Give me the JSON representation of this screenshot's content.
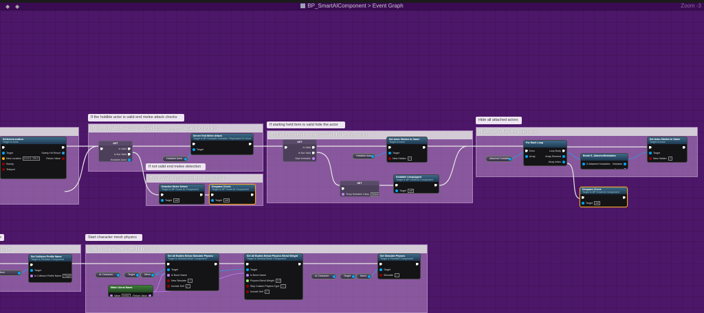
{
  "toolbar": {
    "breadcrumb_blueprint": "BP_SmartAIComponent",
    "breadcrumb_separator": ">",
    "breadcrumb_graph": "Event Graph",
    "zoom": "Zoom -3",
    "back_icon": "arrow-left-icon",
    "forward_icon": "arrow-right-icon"
  },
  "comments": [
    {
      "bubble": "",
      "title": ""
    },
    {
      "bubble": "If the holdble actor is valid end melee attack checks",
      "title": "If the holdble actor is valid end melee attack checks"
    },
    {
      "bubble": "If not valid end melee detection",
      "title": "If not valid end melee detection"
    },
    {
      "bubble": "If starting held item is valid hide the actor",
      "title": "If starting held item is valid hide the actor"
    },
    {
      "bubble": "Hide all attached actors",
      "title": "Hide all attached actors"
    },
    {
      "bubble": "e",
      "title": "rofile"
    },
    {
      "bubble": "Start character mesh physics",
      "title": "Start character mesh physics"
    }
  ],
  "colors": {
    "exec": "#ffffff",
    "object": "#00a8f4",
    "bool": "#920101",
    "name": "#c87eff",
    "float": "#9ef26b",
    "vector": "#f5b50b",
    "selected": "#f5a623"
  },
  "variables": [
    "Holdable Actor",
    "Holdable Actor",
    "Attached Holdables",
    "Mesh",
    "AI Character",
    "Target",
    "Mesh",
    "AI Character",
    "Target",
    "Mesh"
  ],
  "nodes": [
    {
      "title": "SetActorLocation",
      "sub": "Target is Actor",
      "in": [
        [
          "exec",
          ""
        ],
        [
          "object",
          "Target"
        ],
        [
          "vector",
          "New Location",
          "0.0  0.0  -700.0"
        ],
        [
          "bool",
          "Sweep",
          ""
        ],
        [
          "bool",
          "Teleport",
          ""
        ]
      ],
      "out": [
        [
          "exec",
          ""
        ],
        [
          "struct",
          "Sweep Hit Result"
        ],
        [
          "bool",
          "Return Value"
        ]
      ]
    },
    {
      "kind": "macro",
      "title": "GET",
      "in": [
        [
          "exec",
          ""
        ]
      ],
      "out": [
        [
          "exec",
          "Is Valid"
        ],
        [
          "exec",
          "Is Not Valid"
        ],
        [
          "object",
          "Holdable Actor"
        ]
      ]
    },
    {
      "title": "Server End Melee Attack",
      "sub": "Target is BP Holdable Holdable / Replicated To Server (if owning client)",
      "in": [
        [
          "exec",
          ""
        ],
        [
          "object",
          "Target"
        ]
      ],
      "out": [
        [
          "exec",
          ""
        ]
      ]
    },
    {
      "title": "Deactive Melee Detect",
      "sub": "Target is BP Smart AI Component",
      "in": [
        [
          "exec",
          ""
        ],
        [
          "object",
          "Target",
          "self"
        ]
      ],
      "out": [
        [
          "exec",
          ""
        ]
      ]
    },
    {
      "kind": "sel",
      "title": "Despawn Check",
      "sub": "Target is BP Smart AI Component",
      "in": [
        [
          "exec",
          ""
        ],
        [
          "object",
          "Target",
          "self"
        ]
      ],
      "out": [
        [
          "exec",
          ""
        ]
      ]
    },
    {
      "kind": "macro",
      "title": "GET",
      "in": [
        [
          "exec",
          ""
        ]
      ],
      "out": [
        [
          "exec",
          "Is Valid"
        ],
        [
          "exec",
          "Is Not Valid"
        ],
        [
          "name",
          "Start Holdable"
        ]
      ]
    },
    {
      "title": "Set Actor Hidden In Game",
      "sub": "Target is Actor",
      "in": [
        [
          "exec",
          ""
        ],
        [
          "object",
          "Target"
        ],
        [
          "bool",
          "New Hidden",
          "✓"
        ]
      ],
      "out": [
        [
          "exec",
          ""
        ]
      ]
    },
    {
      "kind": "set",
      "title": "SET",
      "in": [
        [
          "exec",
          ""
        ],
        [
          "name",
          "Temp Holdable Class",
          "Select Class"
        ]
      ],
      "out": [
        [
          "exec",
          ""
        ],
        [
          "name",
          ""
        ]
      ]
    },
    {
      "title": "Holdable Unequipped",
      "sub": "Target is BP Smart AI Component",
      "in": [
        [
          "exec",
          ""
        ],
        [
          "object",
          "Target",
          "self"
        ]
      ],
      "out": [
        [
          "exec",
          ""
        ]
      ]
    },
    {
      "title": "For Each Loop",
      "sub": "",
      "in": [
        [
          "exec",
          "Exec"
        ],
        [
          "object",
          "Array"
        ]
      ],
      "out": [
        [
          "exec",
          "Loop Body"
        ],
        [
          "object",
          "Array Element"
        ],
        [
          "object",
          "Array Index"
        ],
        [
          "exec",
          "Completed"
        ]
      ]
    },
    {
      "title": "Break S_AttachedHoldables",
      "sub": "",
      "in": [
        [
          "object",
          "S Attached Holdables"
        ]
      ],
      "out": [
        [
          "object",
          "Holdable"
        ],
        [
          "name",
          "Socket"
        ]
      ]
    },
    {
      "title": "Set Actor Hidden In Game",
      "sub": "Target is Actor",
      "in": [
        [
          "exec",
          ""
        ],
        [
          "object",
          "Target"
        ],
        [
          "bool",
          "New Hidden",
          "✓"
        ]
      ],
      "out": [
        [
          "exec",
          ""
        ]
      ]
    },
    {
      "kind": "sel",
      "title": "Despawn Check",
      "sub": "Target is BP Smart AI Component",
      "in": [
        [
          "exec",
          ""
        ],
        [
          "object",
          "Target",
          "self"
        ]
      ],
      "out": [
        [
          "exec",
          ""
        ]
      ]
    },
    {
      "title": "Set Collision Profile Name",
      "sub": "Target is Primitive Component",
      "in": [
        [
          "exec",
          ""
        ],
        [
          "object",
          "Target"
        ],
        [
          "name",
          "In Collision Profile Name",
          "Ragdoll"
        ]
      ],
      "out": [
        [
          "exec",
          ""
        ]
      ]
    },
    {
      "kind": "pure",
      "title": "Make Literal Name",
      "sub": "",
      "in": [
        [
          "name",
          "Value",
          "pelvis"
        ]
      ],
      "out": [
        [
          "name",
          "Return Value"
        ]
      ]
    },
    {
      "title": "Set All Bodies Below Simulate Physics",
      "sub": "Target is Skeletal Mesh Component",
      "in": [
        [
          "exec",
          ""
        ],
        [
          "object",
          "Target"
        ],
        [
          "name",
          "In Bone Name"
        ],
        [
          "bool",
          "New Simulate",
          "✓"
        ],
        [
          "bool",
          "Include Self",
          "✓"
        ]
      ],
      "out": [
        [
          "exec",
          ""
        ]
      ]
    },
    {
      "title": "Set All Bodies Below Physics Blend Weight",
      "sub": "Target is Skeletal Mesh Component",
      "in": [
        [
          "exec",
          ""
        ],
        [
          "object",
          "Target"
        ],
        [
          "name",
          "In Bone Name"
        ],
        [
          "float",
          "Physics Blend Weight",
          "1.0"
        ],
        [
          "bool",
          "Skip Custom Physics Type",
          "☐"
        ],
        [
          "bool",
          "Include Self",
          "✓"
        ]
      ],
      "out": [
        [
          "exec",
          ""
        ]
      ]
    },
    {
      "title": "Set Simulate Physics",
      "sub": "Target is Primitive Component",
      "in": [
        [
          "exec",
          ""
        ],
        [
          "object",
          "Target"
        ],
        [
          "bool",
          "Simulate",
          "✓"
        ]
      ],
      "out": [
        [
          "exec",
          ""
        ]
      ]
    }
  ]
}
